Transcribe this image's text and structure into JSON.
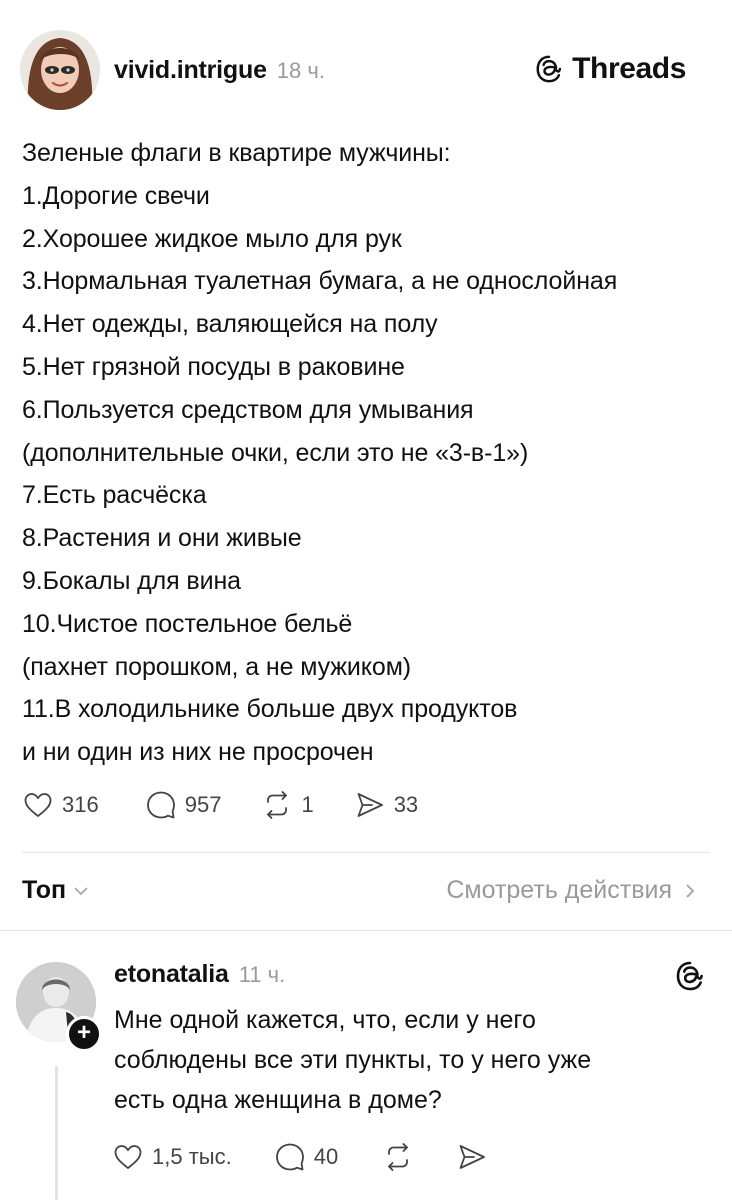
{
  "post": {
    "author": "vivid.intrigue",
    "time": "18 ч.",
    "brand": "Threads",
    "lines": [
      "Зеленые флаги в квартире мужчины:",
      "1.Дорогие свечи",
      "2.Хорошее жидкое мыло для рук",
      "3.Нормальная туалетная бумага, а не однослойная",
      "4.Нет одежды, валяющейся на полу",
      "5.Нет грязной посуды в раковине",
      "6.Пользуется средством для умывания",
      "(дополнительные очки, если это не «3-в-1»)",
      "7.Есть расчёска",
      "8.Растения и они живые",
      "9.Бокалы для вина",
      "10.Чистое постельное бельё",
      "(пахнет порошком, а не мужиком)",
      "11.В холодильнике больше двух продуктов",
      "и ни один из них не просрочен"
    ],
    "actions": {
      "likes": "316",
      "comments": "957",
      "reposts": "1",
      "shares": "33"
    }
  },
  "replies_bar": {
    "sort_label": "Топ",
    "activity_label": "Смотреть действия"
  },
  "reply": {
    "author": "etonatalia",
    "time": "11 ч.",
    "lines": [
      "Мне одной кажется, что, если у него",
      "соблюдены все эти пункты, то у него уже",
      "есть одна женщина в доме?"
    ],
    "actions": {
      "likes": "1,5 тыс.",
      "comments": "40"
    }
  },
  "icons": {
    "like": "heart-icon",
    "comment": "comment-bubble-icon",
    "repost": "repost-icon",
    "share": "share-icon",
    "brand": "threads-logo-icon"
  }
}
